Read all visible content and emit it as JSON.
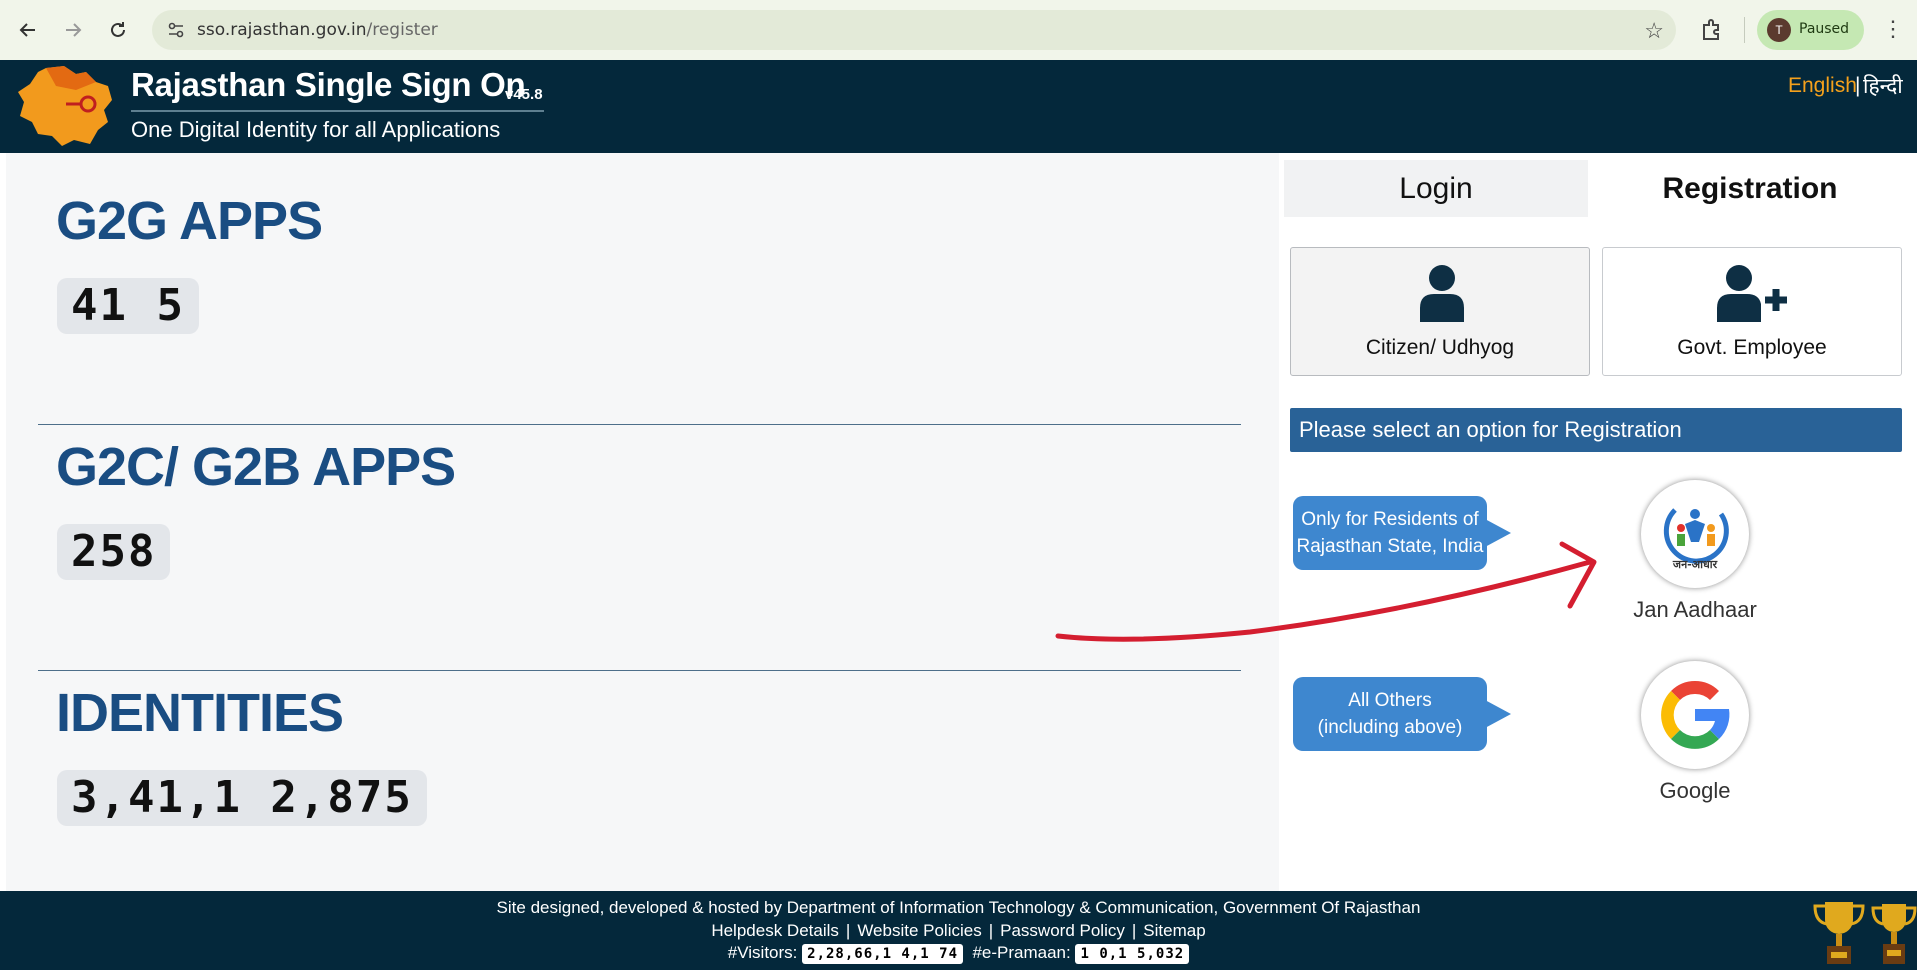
{
  "browser": {
    "url_host": "sso.rajasthan.gov.in",
    "url_path": "/register",
    "profile_initial": "T",
    "profile_status": "Paused"
  },
  "header": {
    "title": "Rajasthan Single Sign On",
    "version": "v45.8",
    "tagline": "One Digital Identity for all Applications",
    "lang_english": "English",
    "lang_separator": "|",
    "lang_hindi": "हिन्दी"
  },
  "stats": [
    {
      "title": "G2G APPS",
      "value": "41 5"
    },
    {
      "title": "G2C/ G2B APPS",
      "value": "258"
    },
    {
      "title": "IDENTITIES",
      "value": "3,41,1 2,875"
    }
  ],
  "tabs": {
    "login": "Login",
    "registration": "Registration"
  },
  "user_types": {
    "citizen": "Citizen/ Udhyog",
    "govt": "Govt. Employee"
  },
  "registration": {
    "banner": "Please select an option for Registration",
    "residents_line1": "Only for Residents of",
    "residents_line2": "Rajasthan State, India",
    "others_line1": "All Others",
    "others_line2": "(including above)",
    "jan_aadhaar": "Jan Aadhaar",
    "google": "Google"
  },
  "footer": {
    "credit": "Site designed, developed & hosted by Department of Information Technology & Communication, Government Of Rajasthan",
    "links": [
      "Helpdesk Details",
      "Website Policies",
      "Password Policy",
      "Sitemap"
    ],
    "visitors_label": "#Visitors:",
    "visitors_value": "2,28,66,1 4,1 74",
    "epramaan_label": "#e-Pramaan:",
    "epramaan_value": "1 0,1 5,032"
  },
  "colors": {
    "header_bg": "#04283b",
    "stat_title": "#1a4d82",
    "banner_bg": "#296297",
    "bubble_bg": "#3e87cf",
    "lang_active": "#f5a11c"
  }
}
